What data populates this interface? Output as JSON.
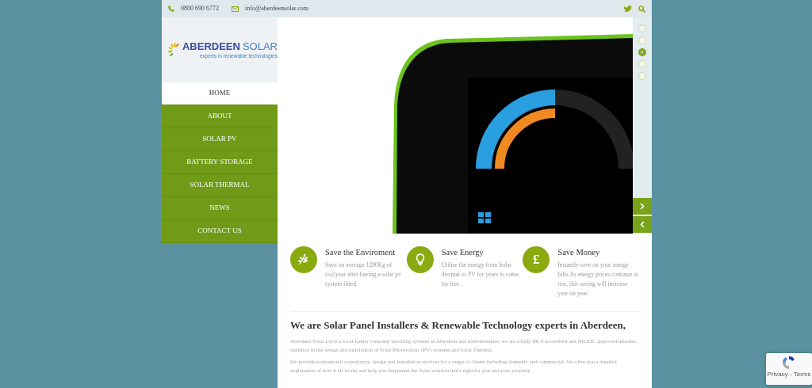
{
  "top_bar": {
    "phone": "0800 690 6772",
    "email": "info@aberdeensolar.com"
  },
  "logo": {
    "name_bold": "ABERDEEN",
    "name_light": "SOLAR",
    "tagline": "experts in renewable technologies"
  },
  "nav": [
    {
      "label": "HOME",
      "selected": true
    },
    {
      "label": "ABOUT",
      "selected": false
    },
    {
      "label": "SOLAR PV",
      "selected": false
    },
    {
      "label": "BATTERY STORAGE",
      "selected": false
    },
    {
      "label": "SOLAR THERMAL",
      "selected": false
    },
    {
      "label": "NEWS",
      "selected": false
    },
    {
      "label": "CONTACT US",
      "selected": false
    }
  ],
  "slider": {
    "bullets": [
      {
        "selected": false
      },
      {
        "selected": false
      },
      {
        "selected": true
      },
      {
        "selected": false
      },
      {
        "selected": false
      }
    ]
  },
  "features": [
    {
      "kind": "leaf",
      "title": "Save the Enviroment",
      "text": "Save on average 1200Kg of co2/year after having a solar pv system fitted."
    },
    {
      "kind": "bulb",
      "title": "Save Energy",
      "text": "Utilise the energy from Solar thermal or PV for years to come for free."
    },
    {
      "kind": "symbol",
      "symbol": "£",
      "title": "Save Money",
      "text": "Instantly save on your energy bills,As energy prices continue to rise, this saving will increase year on year."
    }
  ],
  "intro": {
    "heading": "We are Solar Panel Installers & Renewable Technology experts in Aberdeen,",
    "paragraphs": [
      "Aberdeen Solar Ltd is a local family company installing systems in Aberdeen and Aberdeenshire, we are a fully MCS accredited and NICEIC approved installer, qualified in the design and installation of Solar Photovoltaic (PV) systems and Solar Thermal.",
      "We provide professional consultancy, design and installation services for a range of clients including domestic and commercial. We offer you a detailed explanation of how it all works and help you determine the Solar solution that's right for you and your property."
    ]
  },
  "recaptcha": {
    "label": "Privacy - Terms"
  }
}
